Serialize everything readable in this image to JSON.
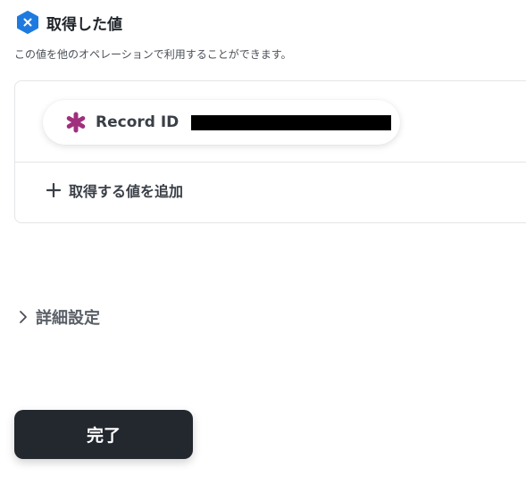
{
  "header": {
    "title": "取得した値",
    "icon": "close-hexagon-icon",
    "icon_color": "#1f7ae0"
  },
  "description": "この値を他のオペレーションで利用することができます。",
  "values": [
    {
      "label": "Record ID",
      "icon": "asterisk-icon",
      "icon_color": "#a0307e",
      "value_redacted": true
    }
  ],
  "add_value_label": "取得する値を追加",
  "advanced_settings_label": "詳細設定",
  "done_button_label": "完了"
}
